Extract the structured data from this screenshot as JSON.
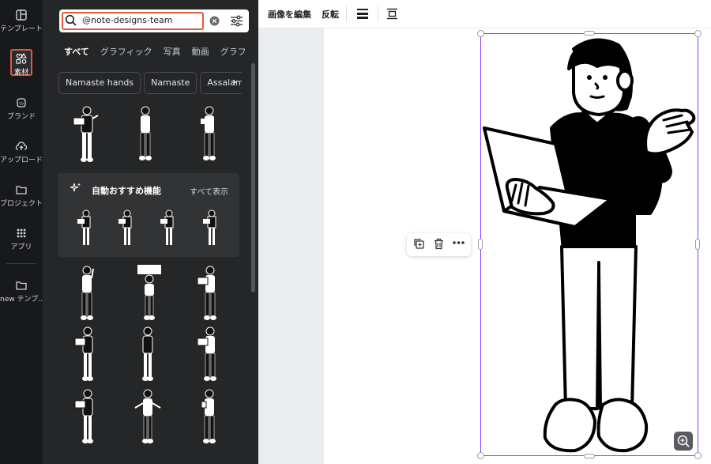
{
  "rail": {
    "items": [
      {
        "label": "テンプレート"
      },
      {
        "label": "素材"
      },
      {
        "label": "ブランド"
      },
      {
        "label": "アップロード"
      },
      {
        "label": "プロジェクト"
      },
      {
        "label": "アプリ"
      },
      {
        "label": "new テンプ..."
      }
    ]
  },
  "panel": {
    "search_value": "@note-designs-team",
    "tabs": [
      "すべて",
      "グラフィック",
      "写真",
      "動画",
      "グラフ"
    ],
    "chips": [
      "Namaste hands",
      "Namaste",
      "Assalam"
    ],
    "card": {
      "title": "自動おすすめ機能",
      "link": "すべて表示"
    }
  },
  "toolbar": {
    "edit_image": "画像を編集",
    "flip": "反転"
  },
  "colors": {
    "accent": "#8b3dff",
    "highlight": "#e05a3c",
    "panel_bg": "#252627",
    "rail_bg": "#18191b"
  }
}
